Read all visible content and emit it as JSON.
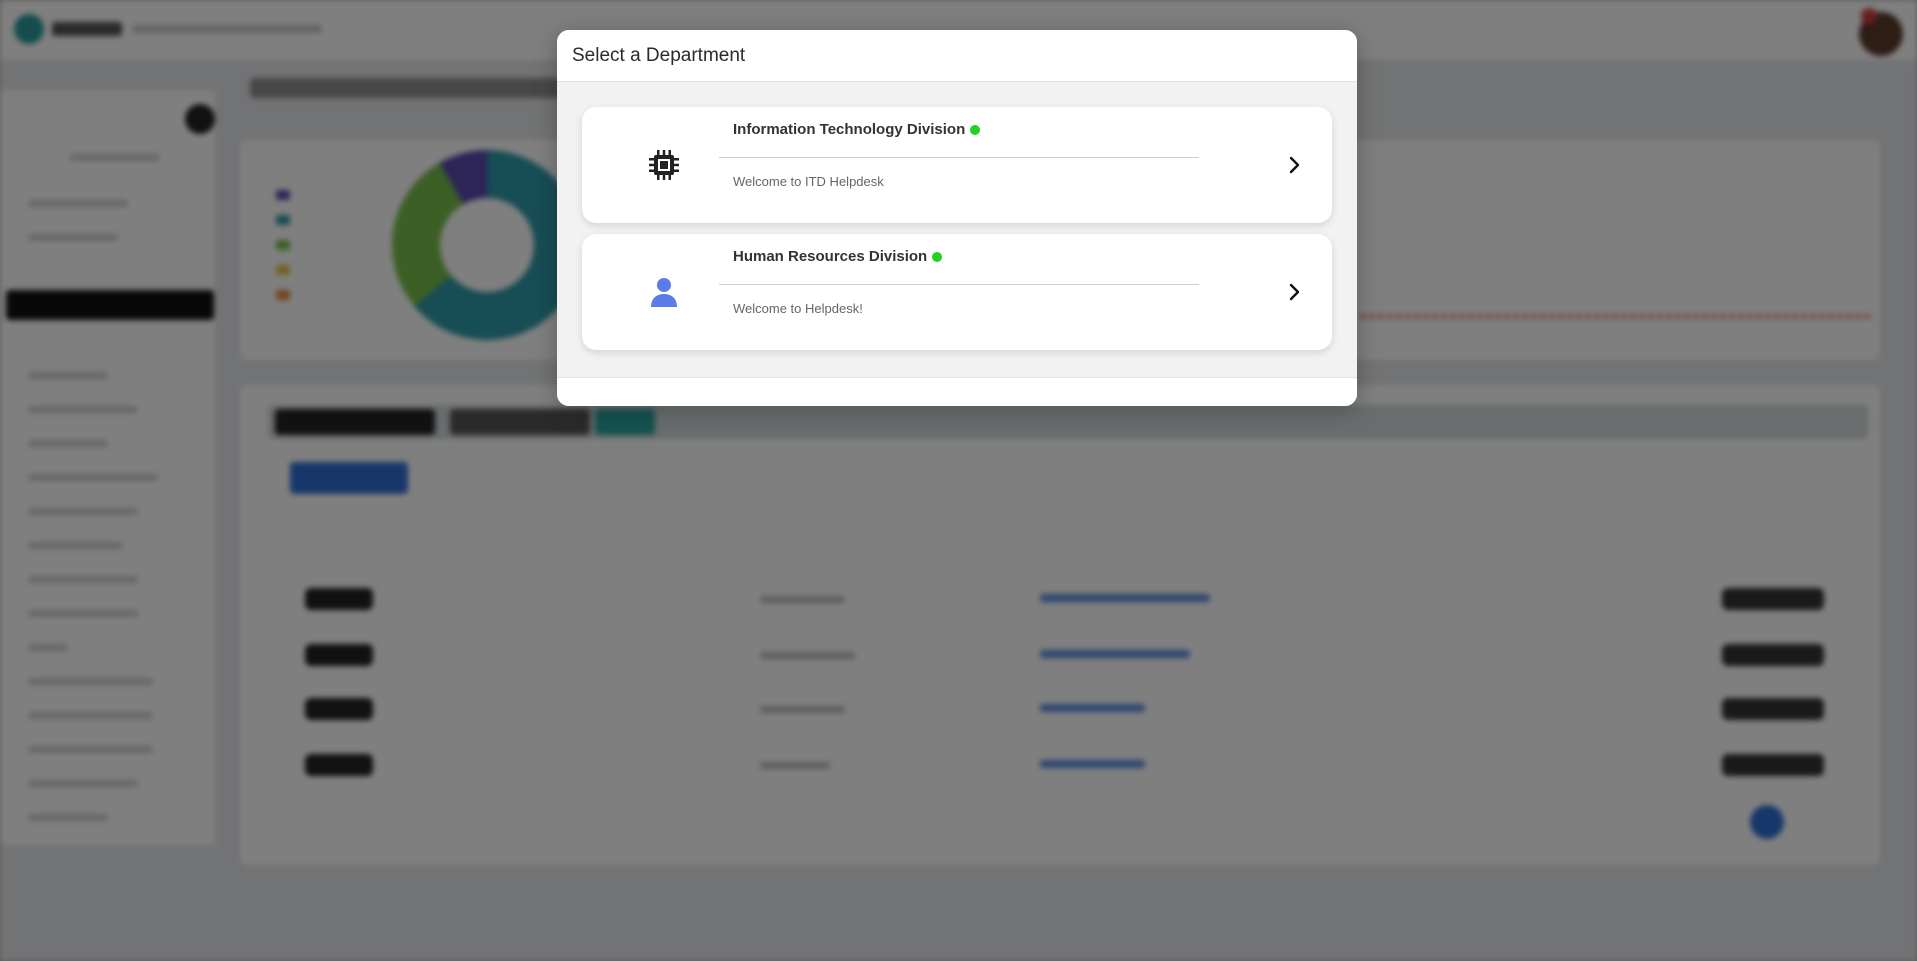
{
  "modal": {
    "title": "Select a Department",
    "departments": [
      {
        "name": "Information Technology Division",
        "description": "Welcome to ITD Helpdesk",
        "icon": "chip-icon",
        "status_color": "#22d122"
      },
      {
        "name": "Human Resources Division",
        "description": "Welcome to Helpdesk!",
        "icon": "person-icon",
        "status_color": "#22d122"
      }
    ]
  },
  "colors": {
    "accent_blue": "#5a7be8",
    "status_online": "#22d122",
    "backdrop": "rgba(0,0,0,0.5)"
  }
}
